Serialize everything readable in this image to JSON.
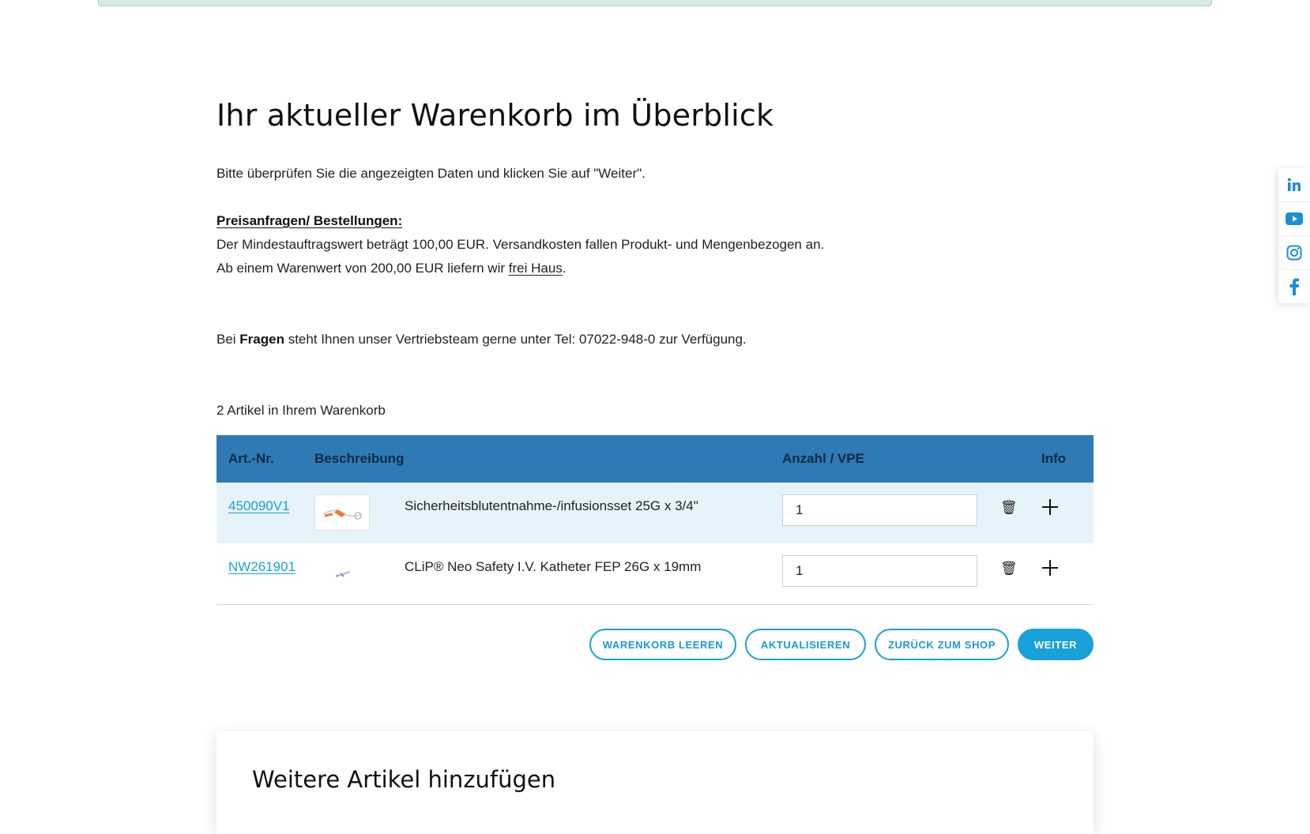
{
  "page": {
    "title": "Ihr aktueller Warenkorb im Überblick",
    "intro": "Bitte überprüfen Sie die angezeigten Daten und klicken Sie auf \"Weiter\".",
    "subheading": "Preisanfragen/ Bestellungen:",
    "min_order": "Der Mindestauftragswert beträgt 100,00 EUR. Versandkosten fallen Produkt- und Mengenbezogen an.",
    "free_shipping_prefix": "Ab einem Warenwert von 200,00 EUR liefern wir ",
    "free_shipping_link": "frei Haus",
    "free_shipping_suffix": ".",
    "contact_prefix": "Bei ",
    "contact_bold": "Fragen",
    "contact_suffix": " steht Ihnen unser Vertriebsteam gerne unter Tel: 07022-948-0 zur Verfügung.",
    "item_count": "2 Artikel in Ihrem Warenkorb"
  },
  "table": {
    "headers": {
      "artnr": "Art.-Nr.",
      "description": "Beschreibung",
      "quantity": "Anzahl / VPE",
      "info": "Info"
    },
    "rows": [
      {
        "artnr": "450090V1",
        "description": "Sicherheitsblutentnahme-/infusionsset 25G x 3/4\"",
        "quantity": "1",
        "image_icon": "infusion-set-thumbnail"
      },
      {
        "artnr": "NW261901",
        "description": "CLiP® Neo Safety I.V. Katheter FEP 26G x 19mm",
        "quantity": "1",
        "image_icon": "catheter-thumbnail"
      }
    ]
  },
  "buttons": {
    "clear": "WARENKORB LEEREN",
    "update": "AKTUALISIEREN",
    "back": "ZURÜCK ZUM SHOP",
    "next": "WEITER"
  },
  "more": {
    "title": "Weitere Artikel hinzufügen"
  },
  "social": [
    "linkedin-icon",
    "youtube-icon",
    "instagram-icon",
    "facebook-icon"
  ],
  "colors": {
    "accent": "#1aa0d8",
    "table_header": "#2f79b5",
    "row_shade": "#e7f3fb"
  }
}
